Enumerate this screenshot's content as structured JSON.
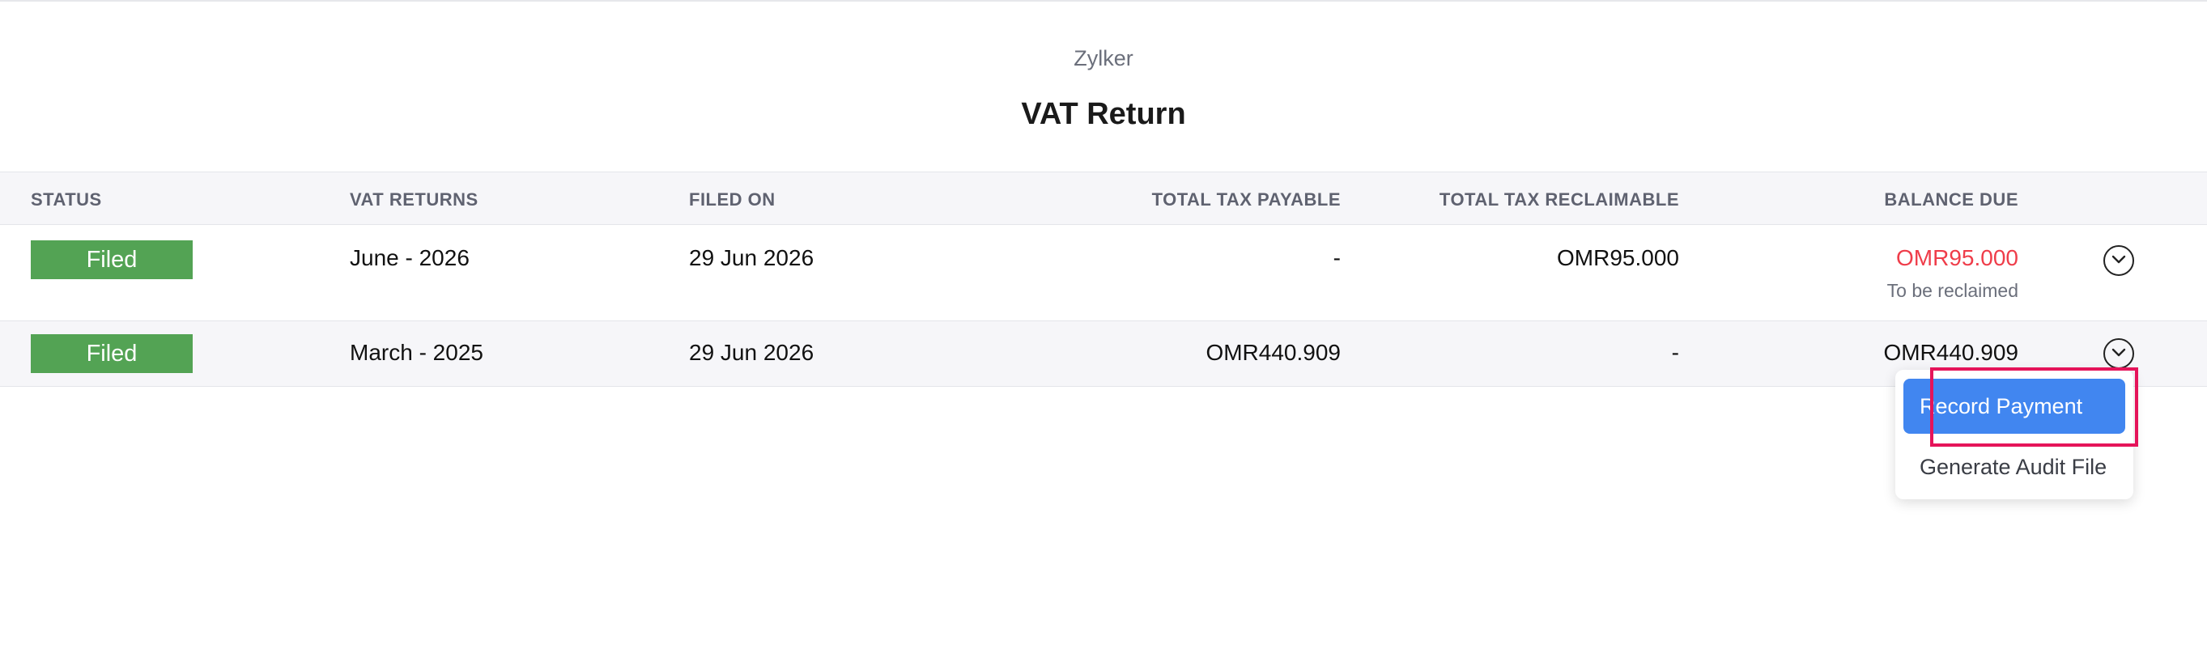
{
  "header": {
    "org_name": "Zylker",
    "title": "VAT Return"
  },
  "table": {
    "columns": {
      "status": "STATUS",
      "vat_returns": "VAT RETURNS",
      "filed_on": "FILED ON",
      "total_tax_payable": "TOTAL TAX PAYABLE",
      "total_tax_reclaimable": "TOTAL TAX RECLAIMABLE",
      "balance_due": "BALANCE DUE"
    },
    "rows": [
      {
        "status": "Filed",
        "vat_return": "June - 2026",
        "filed_on": "29 Jun 2026",
        "total_tax_payable": "-",
        "total_tax_reclaimable": "OMR95.000",
        "balance_due": "OMR95.000",
        "balance_note": "To be reclaimed"
      },
      {
        "status": "Filed",
        "vat_return": "March - 2025",
        "filed_on": "29 Jun 2026",
        "total_tax_payable": "OMR440.909",
        "total_tax_reclaimable": "-",
        "balance_due": "OMR440.909"
      }
    ]
  },
  "dropdown": {
    "items": [
      "Record Payment",
      "Generate Audit File"
    ]
  },
  "colors": {
    "status_filed": "#53a354",
    "balance_reclaim": "#ef3d4a",
    "primary_action": "#4186f0",
    "highlight": "#e5145a"
  },
  "icons": {
    "row_action": "chevron-down-circle-icon"
  }
}
